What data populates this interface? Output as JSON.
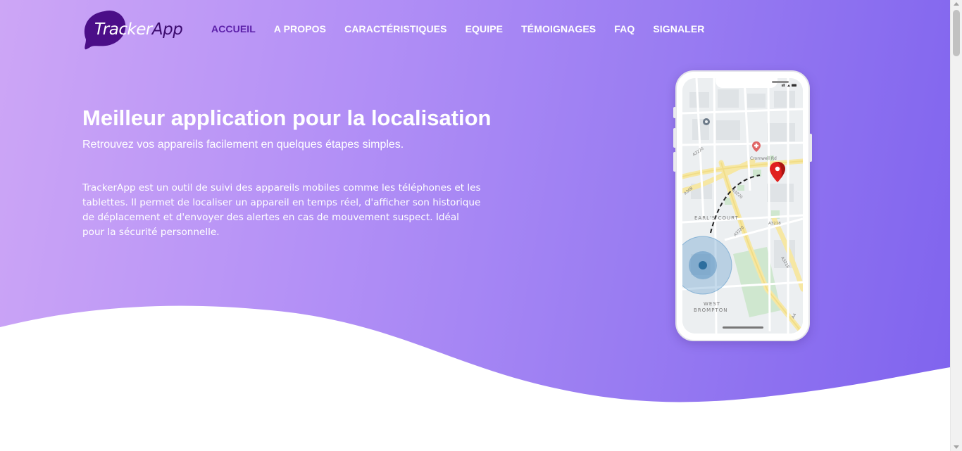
{
  "brand": {
    "logo_text_a": "Tracker",
    "logo_text_b": "App",
    "accent_color": "#5a1ea8",
    "logo_blob_color": "#4b0e88"
  },
  "nav": {
    "items": [
      {
        "label": "ACCUEIL",
        "active": true
      },
      {
        "label": "A PROPOS",
        "active": false
      },
      {
        "label": "CARACTÉRISTIQUES",
        "active": false
      },
      {
        "label": "EQUIPE",
        "active": false
      },
      {
        "label": "TÉMOIGNAGES",
        "active": false
      },
      {
        "label": "FAQ",
        "active": false
      },
      {
        "label": "SIGNALER",
        "active": false
      }
    ]
  },
  "hero": {
    "title": "Meilleur application pour la localisation",
    "subtitle": "Retrouvez vos appareils facilement en quelques étapes simples.",
    "description": "TrackerApp est un outil de suivi des appareils mobiles comme les téléphones et les tablettes. Il permet de localiser un appareil en temps réel, d'afficher son historique de déplacement et d'envoyer des alertes en cas de mouvement suspect. Idéal pour la sécurité personnelle."
  },
  "phone_map": {
    "labels": {
      "cromwell": "Cromwell Rd",
      "earls_court": "EARL'S COURT",
      "west_brompton_1": "WEST",
      "west_brompton_2": "BROMPTON",
      "a3220_1": "A3220",
      "a3220_2": "A3220",
      "a3218": "A3218",
      "a3220_3": "A3220",
      "a3218_b": "A3218",
      "a4": "A4",
      "a308": "A308"
    },
    "icons": [
      "location-pin-icon",
      "hospital-icon",
      "place-icon",
      "user-location-icon",
      "signal-icon",
      "wifi-icon",
      "battery-icon"
    ]
  }
}
